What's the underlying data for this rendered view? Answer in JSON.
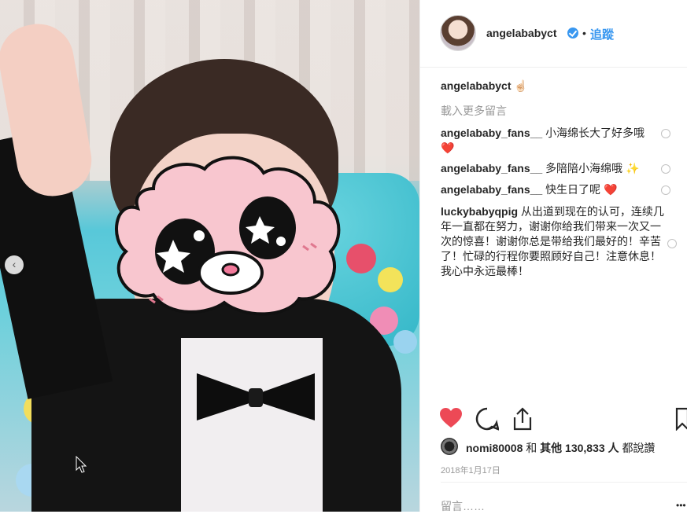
{
  "post": {
    "username": "angelababyct",
    "separator": "•",
    "follow_label": "追蹤",
    "caption_user": "angelababyct",
    "caption_emoji": "☝🏻",
    "load_more": "載入更多留言",
    "comments": [
      {
        "user": "angelababy_fans__",
        "text": "小海绵长大了好多哦",
        "emoji": "❤️"
      },
      {
        "user": "angelababy_fans__",
        "text": "多陪陪小海绵哦",
        "emoji": "✨"
      },
      {
        "user": "angelababy_fans__",
        "text": "快生日了呢",
        "emoji": "❤️"
      },
      {
        "user": "luckybabyqpig",
        "text": "从出道到现在的认可，连续几年一直都在努力，谢谢你给我们带来一次又一次的惊喜！谢谢你总是带给我们最好的！辛苦了！忙碌的行程你要照顾好自己！注意休息！我心中永远最棒！",
        "emoji": ""
      }
    ],
    "likes_user": "nomi80008",
    "likes_and": "和",
    "likes_others": "其他 130,833 人",
    "likes_suffix": "都說讚",
    "date": "2018年1月17日",
    "add_comment_placeholder": "留言……",
    "more_symbol": "•••"
  },
  "icons": {
    "like": "heart-filled-icon",
    "comment": "comment-icon",
    "share": "share-icon",
    "save": "bookmark-icon",
    "verified": "verified-badge-icon",
    "prev_slide": "chevron-left-icon"
  },
  "colors": {
    "link": "#3897f0",
    "like": "#ed4956",
    "muted": "#999999",
    "text": "#262626"
  },
  "photo": {
    "prev_arrow": "‹"
  }
}
